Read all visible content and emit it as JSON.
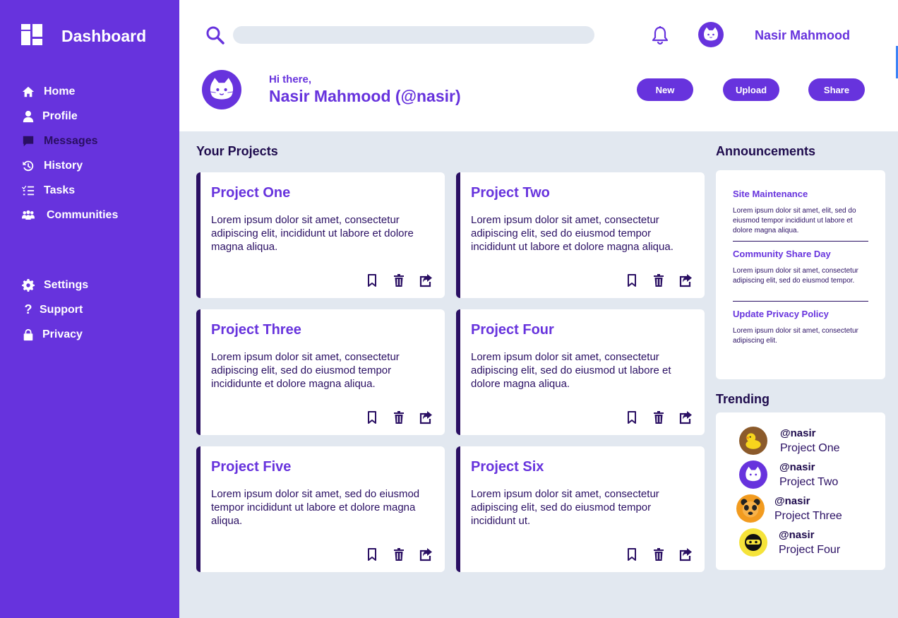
{
  "sidebar": {
    "brand": "Dashboard",
    "items": [
      {
        "label": "Home",
        "icon": "home-icon"
      },
      {
        "label": "Profile",
        "icon": "user-icon"
      },
      {
        "label": "Messages",
        "icon": "message-icon"
      },
      {
        "label": "History",
        "icon": "history-icon"
      },
      {
        "label": "Tasks",
        "icon": "tasks-icon"
      },
      {
        "label": "Communities",
        "icon": "communities-icon"
      }
    ],
    "secondary": [
      {
        "label": "Settings",
        "icon": "gear-icon"
      },
      {
        "label": "Support",
        "icon": "question-icon"
      },
      {
        "label": "Privacy",
        "icon": "lock-icon"
      }
    ]
  },
  "header": {
    "search_placeholder": "",
    "user_name": "Nasir Mahmood",
    "greeting": "Hi there,",
    "greeting_name": "Nasir Mahmood (@nasir)",
    "buttons": {
      "new": "New",
      "upload": "Upload",
      "share": "Share"
    }
  },
  "projects": {
    "title": "Your Projects",
    "items": [
      {
        "title": "Project One",
        "text": "Lorem ipsum dolor sit amet, consectetur adipiscing elit, incididunt ut labore et dolore magna aliqua."
      },
      {
        "title": "Project Two",
        "text": "Lorem ipsum dolor sit amet, consectetur adipiscing elit, sed do eiusmod tempor incididunt ut labore et dolore magna aliqua."
      },
      {
        "title": "Project Three",
        "text": "Lorem ipsum dolor sit amet, consectetur adipiscing elit, sed do eiusmod tempor incididunte et dolore magna aliqua."
      },
      {
        "title": "Project Four",
        "text": "Lorem ipsum dolor sit amet, consectetur adipiscing elit, sed do eiusmod ut labore et dolore magna aliqua."
      },
      {
        "title": "Project Five",
        "text": "Lorem ipsum dolor sit amet, sed do eiusmod tempor incididunt ut labore et dolore magna aliqua."
      },
      {
        "title": "Project Six",
        "text": "Lorem ipsum dolor sit amet, consectetur adipiscing elit, sed do eiusmod tempor incididunt ut."
      }
    ]
  },
  "announcements": {
    "title": "Announcements",
    "items": [
      {
        "title": "Site Maintenance",
        "text": "Lorem ipsum dolor sit amet, elit, sed do eiusmod tempor incididunt ut labore et dolore magna aliqua."
      },
      {
        "title": "Community Share Day",
        "text": "Lorem ipsum dolor sit amet, consectetur adipiscing elit, sed do eiusmod tempor."
      },
      {
        "title": "Update Privacy Policy",
        "text": "Lorem ipsum dolor sit amet, consectetur adipiscing elit."
      }
    ]
  },
  "trending": {
    "title": "Trending",
    "items": [
      {
        "handle": "@nasir",
        "project": "Project One",
        "avatar": "duck-avatar"
      },
      {
        "handle": "@nasir",
        "project": "Project Two",
        "avatar": "cat-avatar"
      },
      {
        "handle": "@nasir",
        "project": "Project Three",
        "avatar": "bear-avatar"
      },
      {
        "handle": "@nasir",
        "project": "Project Four",
        "avatar": "ninja-avatar"
      }
    ]
  },
  "colors": {
    "accent": "#6733dd",
    "dark": "#2a0f63",
    "background": "#e2e8f0"
  }
}
